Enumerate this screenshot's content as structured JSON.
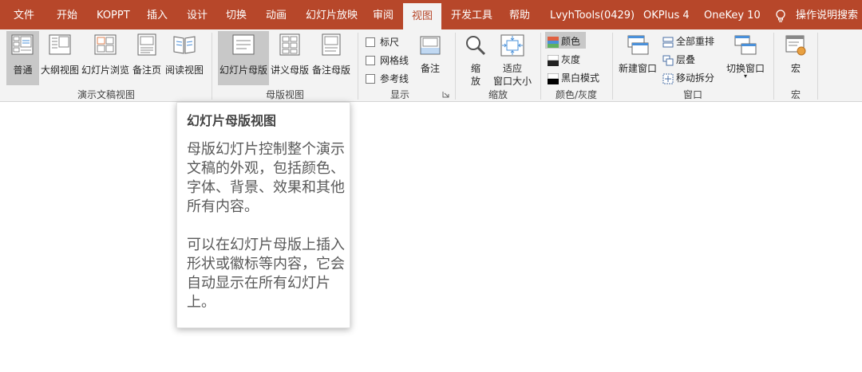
{
  "tabs": [
    "文件",
    "开始",
    "KOPPT",
    "插入",
    "设计",
    "切换",
    "动画",
    "幻灯片放映",
    "审阅",
    "视图",
    "开发工具",
    "帮助",
    "LvyhTools(0429)",
    "OKPlus 4",
    "OneKey 10"
  ],
  "active_tab": "视图",
  "tell_me": "操作说明搜索",
  "groups": {
    "presentation_views": {
      "label": "演示文稿视图",
      "buttons": [
        "普通",
        "大纲视图",
        "幻灯片浏览",
        "备注页",
        "阅读视图"
      ]
    },
    "master_views": {
      "label": "母版视图",
      "buttons": [
        "幻灯片母版",
        "讲义母版",
        "备注母版"
      ]
    },
    "show": {
      "label": "显示",
      "checkboxes": [
        "标尺",
        "网格线",
        "参考线"
      ],
      "notes": "备注"
    },
    "zoom": {
      "label": "缩放",
      "zoom_line1": "缩",
      "zoom_line2": "放",
      "fit_line1": "适应",
      "fit_line2": "窗口大小"
    },
    "color": {
      "label": "颜色/灰度",
      "options": [
        "颜色",
        "灰度",
        "黑白模式"
      ]
    },
    "window": {
      "label": "窗口",
      "new_window": "新建窗口",
      "arrange_all": "全部重排",
      "cascade": "层叠",
      "move_split": "移动拆分",
      "switch_windows": "切换窗口"
    },
    "macros": {
      "label": "宏",
      "macro_button": "宏"
    }
  },
  "tooltip": {
    "title": "幻灯片母版视图",
    "paragraph1": "母版幻灯片控制整个演示文稿的外观，包括颜色、字体、背景、效果和其他所有内容。",
    "paragraph2": "可以在幻灯片母版上插入形状或徽标等内容，它会自动显示在所有幻灯片上。"
  },
  "colors": {
    "tab_bar": "#b7472a",
    "ribbon": "#f3f3f3",
    "pressed": "#c8c8c8",
    "accent_blue": "#2e75b6"
  }
}
